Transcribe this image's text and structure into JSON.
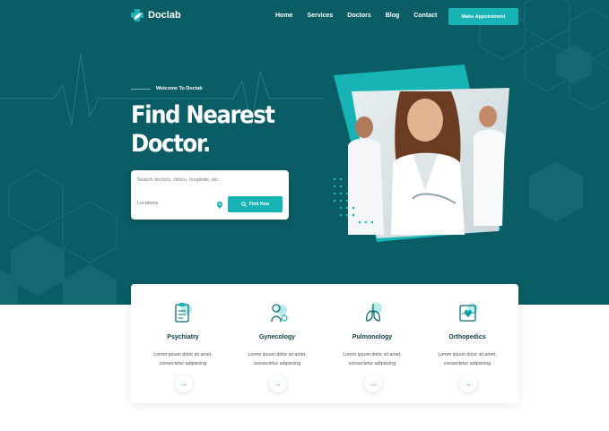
{
  "brand": {
    "name": "Doclab",
    "accent": "#17b3b5",
    "dark": "#0a5c65"
  },
  "nav": {
    "items": [
      "Home",
      "Services",
      "Doctors",
      "Blog",
      "Contact"
    ],
    "cta": "Make Appointment"
  },
  "hero": {
    "welcome": "Welcome To Doclab",
    "title_line1": "Find Nearest",
    "title_line2": "Doctor.",
    "search_placeholder": "Search doctors, clinics, hospitals, etc.",
    "location_placeholder": "Locations",
    "find_label": "Find Now"
  },
  "services": [
    {
      "title": "Psychiatry",
      "desc1": "Lorem ipsum dolor sit amet,",
      "desc2": "consectetur adipiscing",
      "icon": "clipboard-icon"
    },
    {
      "title": "Gynecology",
      "desc1": "Lorem ipsum dolor sit amet,",
      "desc2": "consectetur adipiscing",
      "icon": "gynecology-icon"
    },
    {
      "title": "Pulmonology",
      "desc1": "Lorem ipsum dolor sit amet,",
      "desc2": "consectetur adipiscing",
      "icon": "lungs-icon"
    },
    {
      "title": "Orthopedics",
      "desc1": "Lorem ipsum dolor sit amet,",
      "desc2": "consectetur adipiscing",
      "icon": "heart-monitor-icon"
    }
  ]
}
